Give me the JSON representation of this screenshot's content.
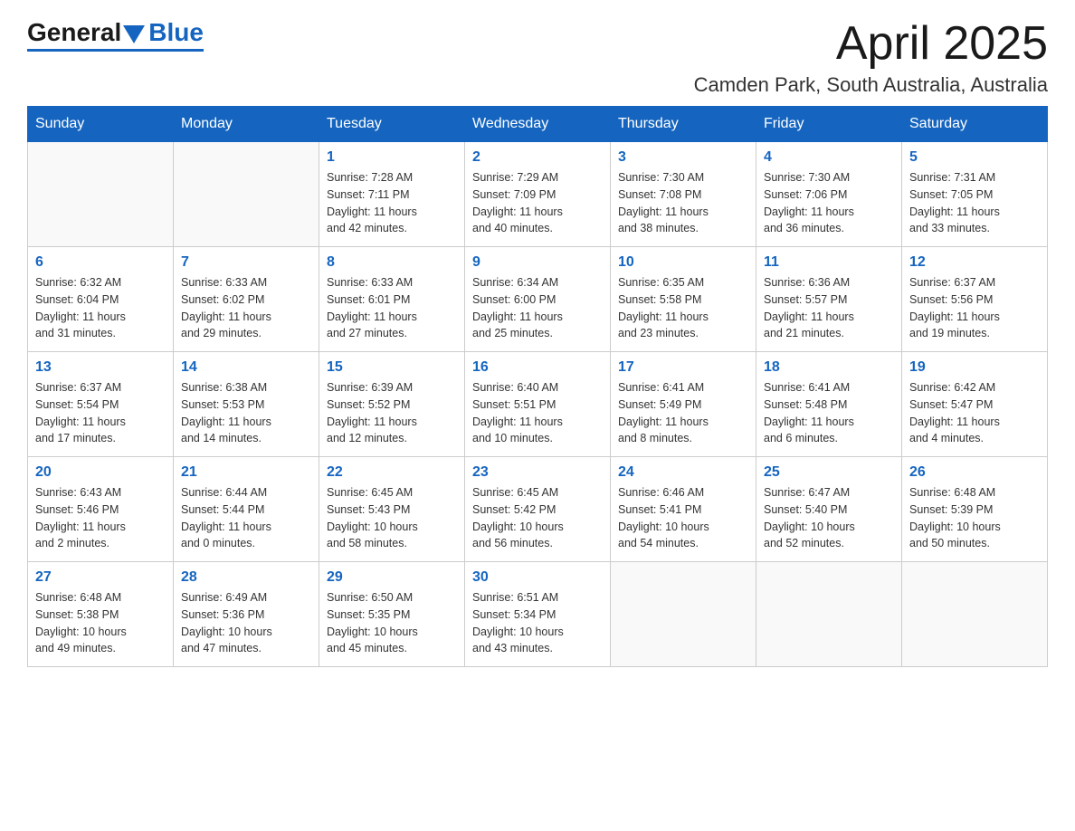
{
  "logo": {
    "general": "General",
    "blue": "Blue"
  },
  "title": "April 2025",
  "location": "Camden Park, South Australia, Australia",
  "days_of_week": [
    "Sunday",
    "Monday",
    "Tuesday",
    "Wednesday",
    "Thursday",
    "Friday",
    "Saturday"
  ],
  "weeks": [
    [
      {
        "day": "",
        "info": ""
      },
      {
        "day": "",
        "info": ""
      },
      {
        "day": "1",
        "info": "Sunrise: 7:28 AM\nSunset: 7:11 PM\nDaylight: 11 hours\nand 42 minutes."
      },
      {
        "day": "2",
        "info": "Sunrise: 7:29 AM\nSunset: 7:09 PM\nDaylight: 11 hours\nand 40 minutes."
      },
      {
        "day": "3",
        "info": "Sunrise: 7:30 AM\nSunset: 7:08 PM\nDaylight: 11 hours\nand 38 minutes."
      },
      {
        "day": "4",
        "info": "Sunrise: 7:30 AM\nSunset: 7:06 PM\nDaylight: 11 hours\nand 36 minutes."
      },
      {
        "day": "5",
        "info": "Sunrise: 7:31 AM\nSunset: 7:05 PM\nDaylight: 11 hours\nand 33 minutes."
      }
    ],
    [
      {
        "day": "6",
        "info": "Sunrise: 6:32 AM\nSunset: 6:04 PM\nDaylight: 11 hours\nand 31 minutes."
      },
      {
        "day": "7",
        "info": "Sunrise: 6:33 AM\nSunset: 6:02 PM\nDaylight: 11 hours\nand 29 minutes."
      },
      {
        "day": "8",
        "info": "Sunrise: 6:33 AM\nSunset: 6:01 PM\nDaylight: 11 hours\nand 27 minutes."
      },
      {
        "day": "9",
        "info": "Sunrise: 6:34 AM\nSunset: 6:00 PM\nDaylight: 11 hours\nand 25 minutes."
      },
      {
        "day": "10",
        "info": "Sunrise: 6:35 AM\nSunset: 5:58 PM\nDaylight: 11 hours\nand 23 minutes."
      },
      {
        "day": "11",
        "info": "Sunrise: 6:36 AM\nSunset: 5:57 PM\nDaylight: 11 hours\nand 21 minutes."
      },
      {
        "day": "12",
        "info": "Sunrise: 6:37 AM\nSunset: 5:56 PM\nDaylight: 11 hours\nand 19 minutes."
      }
    ],
    [
      {
        "day": "13",
        "info": "Sunrise: 6:37 AM\nSunset: 5:54 PM\nDaylight: 11 hours\nand 17 minutes."
      },
      {
        "day": "14",
        "info": "Sunrise: 6:38 AM\nSunset: 5:53 PM\nDaylight: 11 hours\nand 14 minutes."
      },
      {
        "day": "15",
        "info": "Sunrise: 6:39 AM\nSunset: 5:52 PM\nDaylight: 11 hours\nand 12 minutes."
      },
      {
        "day": "16",
        "info": "Sunrise: 6:40 AM\nSunset: 5:51 PM\nDaylight: 11 hours\nand 10 minutes."
      },
      {
        "day": "17",
        "info": "Sunrise: 6:41 AM\nSunset: 5:49 PM\nDaylight: 11 hours\nand 8 minutes."
      },
      {
        "day": "18",
        "info": "Sunrise: 6:41 AM\nSunset: 5:48 PM\nDaylight: 11 hours\nand 6 minutes."
      },
      {
        "day": "19",
        "info": "Sunrise: 6:42 AM\nSunset: 5:47 PM\nDaylight: 11 hours\nand 4 minutes."
      }
    ],
    [
      {
        "day": "20",
        "info": "Sunrise: 6:43 AM\nSunset: 5:46 PM\nDaylight: 11 hours\nand 2 minutes."
      },
      {
        "day": "21",
        "info": "Sunrise: 6:44 AM\nSunset: 5:44 PM\nDaylight: 11 hours\nand 0 minutes."
      },
      {
        "day": "22",
        "info": "Sunrise: 6:45 AM\nSunset: 5:43 PM\nDaylight: 10 hours\nand 58 minutes."
      },
      {
        "day": "23",
        "info": "Sunrise: 6:45 AM\nSunset: 5:42 PM\nDaylight: 10 hours\nand 56 minutes."
      },
      {
        "day": "24",
        "info": "Sunrise: 6:46 AM\nSunset: 5:41 PM\nDaylight: 10 hours\nand 54 minutes."
      },
      {
        "day": "25",
        "info": "Sunrise: 6:47 AM\nSunset: 5:40 PM\nDaylight: 10 hours\nand 52 minutes."
      },
      {
        "day": "26",
        "info": "Sunrise: 6:48 AM\nSunset: 5:39 PM\nDaylight: 10 hours\nand 50 minutes."
      }
    ],
    [
      {
        "day": "27",
        "info": "Sunrise: 6:48 AM\nSunset: 5:38 PM\nDaylight: 10 hours\nand 49 minutes."
      },
      {
        "day": "28",
        "info": "Sunrise: 6:49 AM\nSunset: 5:36 PM\nDaylight: 10 hours\nand 47 minutes."
      },
      {
        "day": "29",
        "info": "Sunrise: 6:50 AM\nSunset: 5:35 PM\nDaylight: 10 hours\nand 45 minutes."
      },
      {
        "day": "30",
        "info": "Sunrise: 6:51 AM\nSunset: 5:34 PM\nDaylight: 10 hours\nand 43 minutes."
      },
      {
        "day": "",
        "info": ""
      },
      {
        "day": "",
        "info": ""
      },
      {
        "day": "",
        "info": ""
      }
    ]
  ]
}
